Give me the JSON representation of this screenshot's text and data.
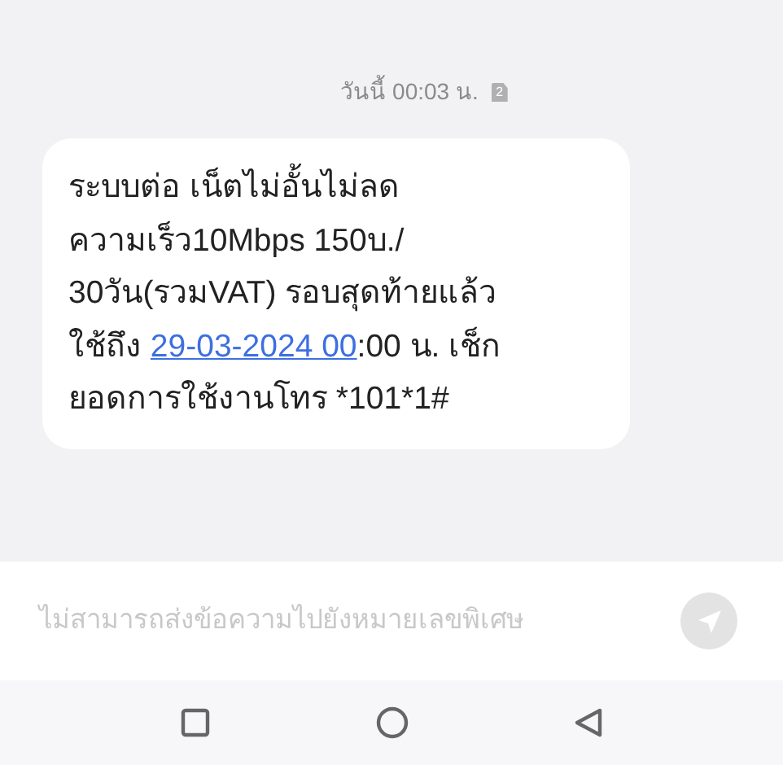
{
  "timestamp": {
    "text": "วันนี้ 00:03 น.",
    "sim": "2"
  },
  "message": {
    "segments": [
      {
        "kind": "text",
        "text": "ระบบต่อ เน็ตไม่อั้นไม่ลด\nความเร็ว10Mbps 150บ./\n30วัน(รวมVAT) รอบสุดท้ายแล้ว\nใช้ถึง "
      },
      {
        "kind": "link",
        "text": "29-03-2024 00"
      },
      {
        "kind": "text",
        "text": ":00 น. เช็ก\nยอดการใช้งานโทร *101*1#"
      }
    ]
  },
  "composer": {
    "placeholder": "ไม่สามารถส่งข้อความไปยังหมายเลขพิเศษ",
    "send_disabled": true
  }
}
